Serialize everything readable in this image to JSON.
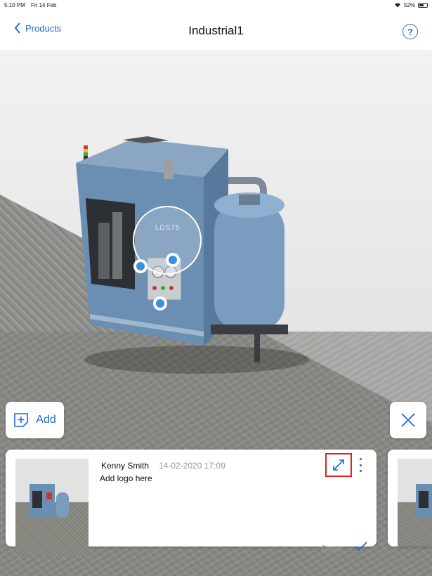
{
  "status_bar": {
    "time": "5:10 PM",
    "date": "Fri 14 Feb",
    "battery": "52%"
  },
  "header": {
    "back_label": "Products",
    "title": "Industrial1",
    "help_symbol": "?"
  },
  "scene": {
    "machine_label": "LDS75"
  },
  "actions": {
    "add_label": "Add"
  },
  "annotation": {
    "author": "Kenny Smith",
    "timestamp": "14-02-2020 17:09",
    "text": "Add logo here",
    "done_label": "Done"
  },
  "colors": {
    "accent": "#1e6bd6",
    "highlight": "#e02020",
    "machine_blue": "#6a8fb3"
  }
}
